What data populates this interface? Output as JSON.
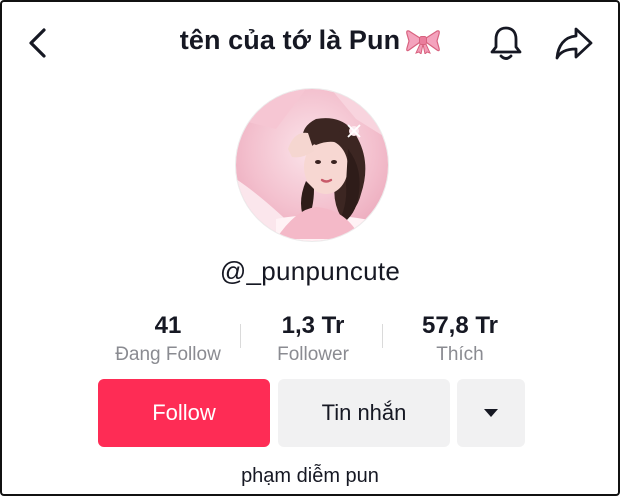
{
  "header": {
    "title": "tên của tớ là Pun",
    "title_emoji": "ribbon-bow-icon",
    "back_icon": "chevron-left-icon",
    "bell_icon": "bell-icon",
    "share_icon": "share-arrow-icon"
  },
  "profile": {
    "username": "@_punpuncute",
    "bio": "phạm diễm pun"
  },
  "stats": [
    {
      "value": "41",
      "label": "Đang Follow"
    },
    {
      "value": "1,3 Tr",
      "label": "Follower"
    },
    {
      "value": "57,8 Tr",
      "label": "Thích"
    }
  ],
  "actions": {
    "follow_label": "Follow",
    "message_label": "Tin nhắn",
    "more_icon": "caret-down-icon"
  },
  "colors": {
    "accent": "#fe2c55",
    "secondary_button": "#f1f1f2",
    "muted_text": "#8a8b91",
    "text": "#161823"
  }
}
